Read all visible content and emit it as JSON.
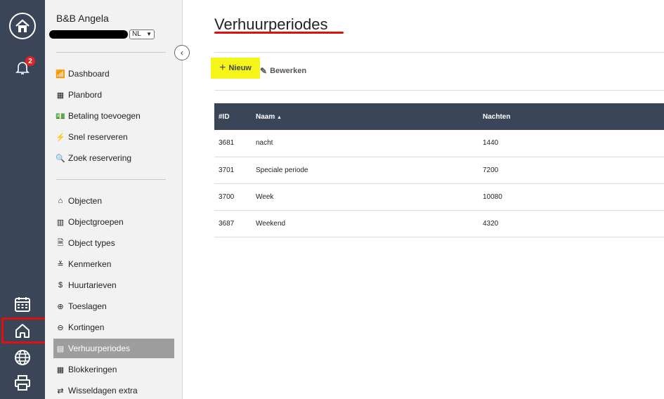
{
  "rail": {
    "icons": [
      "home-logo-icon",
      "bell-icon",
      "calendar-icon",
      "house-icon",
      "globe-icon",
      "printer-icon"
    ],
    "notification_count": "2"
  },
  "sidebar": {
    "property_name": "B&B Angela",
    "language": "NL",
    "group1": [
      {
        "label": "Dashboard",
        "icon": "chart-icon"
      },
      {
        "label": "Planbord",
        "icon": "grid-icon"
      },
      {
        "label": "Betaling toevoegen",
        "icon": "money-icon"
      },
      {
        "label": "Snel reserveren",
        "icon": "bolt-icon"
      },
      {
        "label": "Zoek reservering",
        "icon": "search-icon"
      }
    ],
    "group2": [
      {
        "label": "Objecten",
        "icon": "house-icon"
      },
      {
        "label": "Objectgroepen",
        "icon": "buildings-icon"
      },
      {
        "label": "Object types",
        "icon": "type-icon"
      },
      {
        "label": "Kenmerken",
        "icon": "amenity-icon"
      },
      {
        "label": "Huurtarieven",
        "icon": "dollar-icon"
      },
      {
        "label": "Toeslagen",
        "icon": "plus-circle-icon"
      },
      {
        "label": "Kortingen",
        "icon": "minus-circle-icon"
      },
      {
        "label": "Verhuurperiodes",
        "icon": "calendar-icon",
        "active": true
      },
      {
        "label": "Blokkeringen",
        "icon": "calendar-block-icon"
      },
      {
        "label": "Wisseldagen extra",
        "icon": "swap-icon"
      }
    ]
  },
  "main": {
    "title": "Verhuurperiodes",
    "toolbar": {
      "new_label": "Nieuw",
      "edit_label": "Bewerken"
    },
    "table": {
      "columns": [
        "#ID",
        "Naam",
        "Nachten"
      ],
      "sort_indicator": "▲",
      "rows": [
        {
          "id": "3681",
          "naam": "nacht",
          "nachten": "1440"
        },
        {
          "id": "3701",
          "naam": "Speciale periode",
          "nachten": "7200"
        },
        {
          "id": "3700",
          "naam": "Week",
          "nachten": "10080"
        },
        {
          "id": "3687",
          "naam": "Weekend",
          "nachten": "4320"
        }
      ]
    }
  },
  "colors": {
    "rail_bg": "#3b4558",
    "highlight": "#f5f51a",
    "annotation_red": "#e01010",
    "active_nav": "#9e9e9e"
  }
}
